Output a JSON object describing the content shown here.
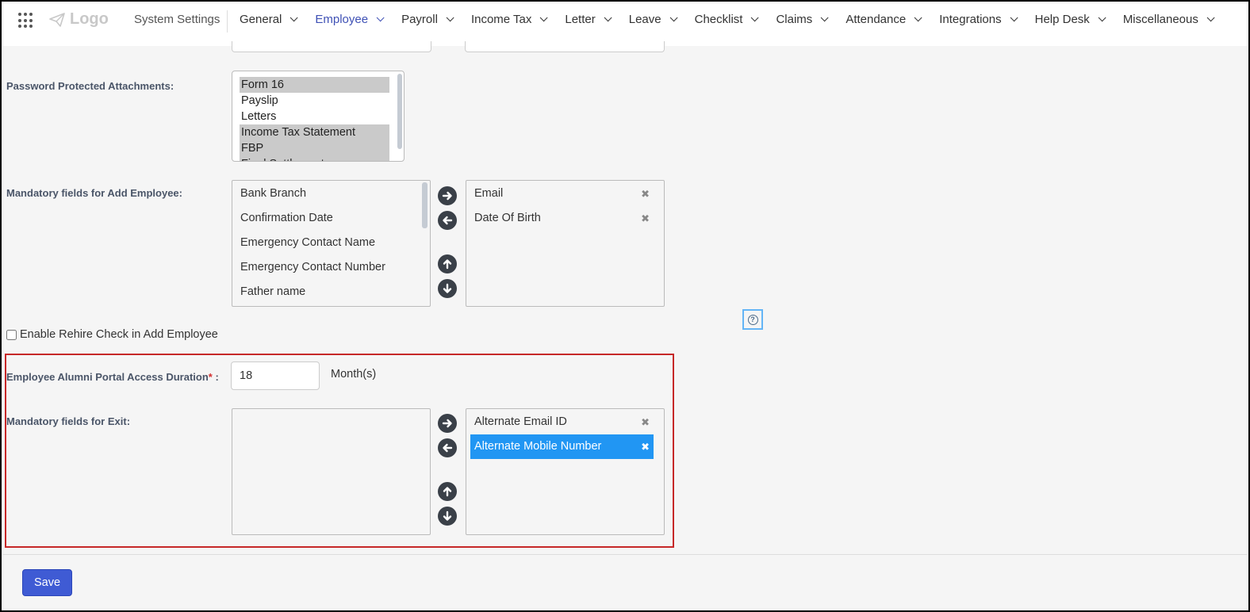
{
  "header": {
    "logo_text": "Logo",
    "system_settings": "System Settings",
    "nav": [
      {
        "label": "General"
      },
      {
        "label": "Employee"
      },
      {
        "label": "Payroll"
      },
      {
        "label": "Income Tax"
      },
      {
        "label": "Letter"
      },
      {
        "label": "Leave"
      },
      {
        "label": "Checklist"
      },
      {
        "label": "Claims"
      },
      {
        "label": "Attendance"
      },
      {
        "label": "Integrations"
      },
      {
        "label": "Help Desk"
      },
      {
        "label": "Miscellaneous"
      }
    ],
    "active_nav": "Employee"
  },
  "password_attachments": {
    "label": "Password Protected Attachments:",
    "options": [
      {
        "label": "Form 16",
        "selected": true
      },
      {
        "label": "Payslip",
        "selected": false
      },
      {
        "label": "Letters",
        "selected": false
      },
      {
        "label": "Income Tax Statement",
        "selected": true
      },
      {
        "label": "FBP",
        "selected": true
      },
      {
        "label": "Final Settlement",
        "selected": true
      }
    ]
  },
  "mandatory_add_employee": {
    "label": "Mandatory fields for Add Employee:",
    "available": [
      "Bank Branch",
      "Confirmation Date",
      "Emergency Contact Name",
      "Emergency Contact Number",
      "Father name"
    ],
    "chosen": [
      "Email",
      "Date Of Birth"
    ]
  },
  "rehire_check": {
    "label": "Enable Rehire Check in Add Employee",
    "checked": false
  },
  "alumni_access": {
    "label": "Employee Alumni Portal Access Duration",
    "required_mark": "*",
    "suffix": " :",
    "value": "18",
    "unit": "Month(s)"
  },
  "mandatory_exit": {
    "label": "Mandatory fields for Exit:",
    "available": [],
    "chosen": [
      {
        "label": "Alternate Email ID",
        "selected": false
      },
      {
        "label": "Alternate Mobile Number",
        "selected": true
      }
    ]
  },
  "remove_glyph": "✖",
  "help_glyph": "?",
  "save_label": "Save",
  "colors": {
    "accent": "#3f51b5",
    "save_button": "#3f5bd4",
    "selected_item": "#2196f3",
    "highlight_border": "#c62828",
    "required": "#d32f2f"
  }
}
